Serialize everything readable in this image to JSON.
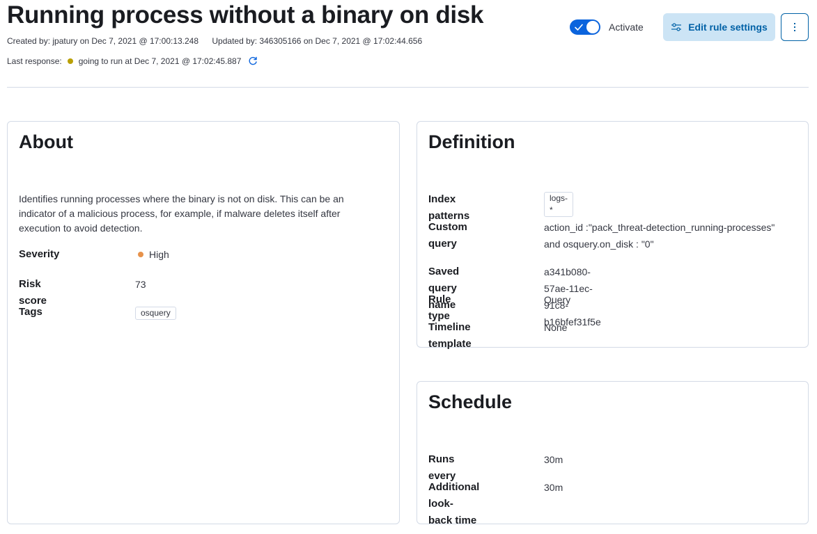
{
  "header": {
    "title": "Running process without a binary on disk",
    "created": "Created by: jpatury on Dec 7, 2021 @ 17:00:13.248",
    "updated": "Updated by: 346305166 on Dec 7, 2021 @ 17:02:44.656",
    "last_response_label": "Last response:",
    "last_response_status": "going to run at Dec 7, 2021 @ 17:02:45.887",
    "status_color": "#b9a006"
  },
  "actions": {
    "activate_label": "Activate",
    "activate_on": true,
    "edit_label": "Edit rule settings",
    "accent": "#0b64dd",
    "more_icon": "boxes-vertical-icon"
  },
  "about": {
    "title": "About",
    "description": "Identifies running processes where the binary is not on disk. This can be an indicator of a malicious process, for example, if malware deletes itself after execution to avoid detection.",
    "severity_label": "Severity",
    "severity_value": "High",
    "severity_color": "#e7924b",
    "risk_label": "Risk score",
    "risk_value": "73",
    "tags_label": "Tags",
    "tags": [
      "osquery"
    ]
  },
  "definition": {
    "title": "Definition",
    "index_label": "Index patterns",
    "index_value": "logs-*",
    "query_label": "Custom query",
    "query_line1": "action_id :\"pack_threat-detection_running-processes\"",
    "query_line2": "and osquery.on_disk : \"0\"",
    "saved_label": "Saved query name",
    "saved_value": "a341b080-57ae-11ec-91c8-b16bfef31f5e",
    "type_label": "Rule type",
    "type_value": "Query",
    "timeline_label": "Timeline template",
    "timeline_value": "None"
  },
  "schedule": {
    "title": "Schedule",
    "runs_label": "Runs every",
    "runs_value": "30m",
    "lookback_label_1": "Additional look-",
    "lookback_label_2": "back time",
    "lookback_value": "30m"
  }
}
